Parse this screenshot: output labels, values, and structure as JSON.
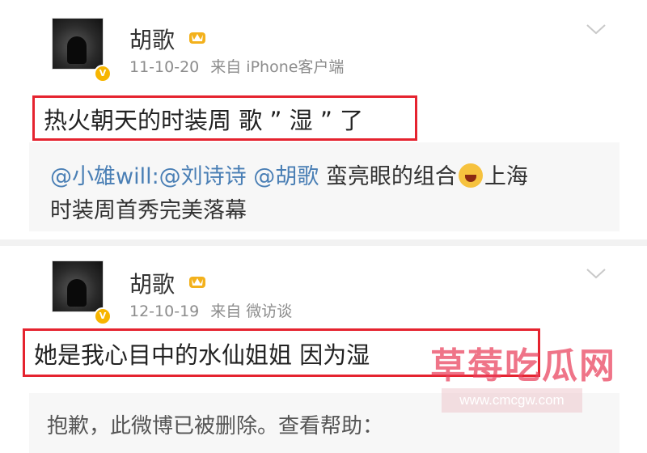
{
  "post1": {
    "username": "胡歌",
    "date": "11-10-20",
    "source": "来自 iPhone客户端",
    "content": "热火朝天的时装周 歌 ” 湿 ” 了",
    "repost": {
      "mentions": "@小雄will:@刘诗诗 @胡歌",
      "text_part1": " 蛮亮眼的组合",
      "text_part2": "上海",
      "text_line2": "时装周首秀完美落幕"
    }
  },
  "post2": {
    "username": "胡歌",
    "date": "12-10-19",
    "source": "来自 微访谈",
    "content": "她是我心目中的水仙姐姐 因为湿",
    "deleted_notice": "抱歉，此微博已被删除。查看帮助："
  },
  "watermark": {
    "text": "草莓吃瓜网",
    "url": "www.cmcgw.com"
  },
  "icons": {
    "verified": "verified-v-badge",
    "member": "crown-icon",
    "more": "chevron-down-icon"
  },
  "colors": {
    "highlight_border": "#e5232f",
    "mention": "#4a7fb5",
    "verified_badge": "#f7b500",
    "watermark": "#e93e5a"
  }
}
